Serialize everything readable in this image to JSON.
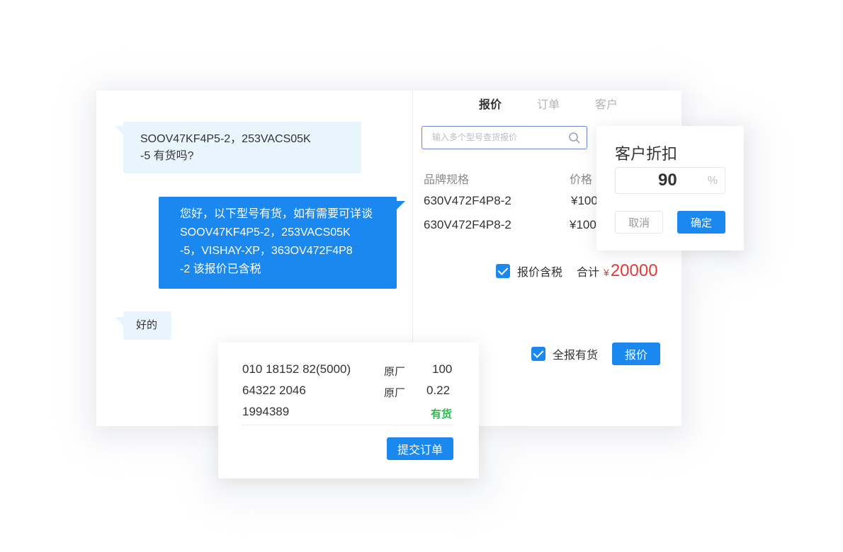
{
  "chat": {
    "msg_incoming_1": [
      "SOOV47KF4P5-2，253VACS05K",
      "-5 有货吗?"
    ],
    "msg_outgoing": [
      "您好，以下型号有货，如有需要可详谈",
      "SOOV47KF4P5-2，253VACS05K",
      "-5，VISHAY-XP，363OV472F4P8",
      "-2 该报价已含税"
    ],
    "msg_incoming_2": "好的"
  },
  "tabs": [
    {
      "label": "报价",
      "active": true
    },
    {
      "label": "订单",
      "active": false
    },
    {
      "label": "客户",
      "active": false
    }
  ],
  "search": {
    "placeholder": "输入多个型号查货报价",
    "icon": "search-icon"
  },
  "table": {
    "headers": {
      "brand_spec": "品牌规格",
      "price": "价格"
    },
    "rows": [
      {
        "spec": "630V472F4P8-2",
        "price": "¥100"
      },
      {
        "spec": "630V472F4P8-2",
        "price": "¥100"
      }
    ]
  },
  "tax": {
    "label": "报价含税",
    "checked": true
  },
  "total": {
    "label": "合计",
    "currency": "¥",
    "amount": "20000"
  },
  "all_stock": {
    "label": "全报有货",
    "checked": true
  },
  "quote_button": "报价",
  "discount_popup": {
    "title": "客户折扣",
    "value": "90",
    "unit": "%",
    "cancel": "取消",
    "confirm": "确定"
  },
  "order_popup": {
    "rows": [
      {
        "part": "010 18152 82(5000)",
        "brand": "原厂",
        "value": "100"
      },
      {
        "part": "64322 2046",
        "brand": "原厂",
        "value": "0.22"
      },
      {
        "part": "1994389",
        "brand": "",
        "value": "有货"
      }
    ],
    "submit": "提交订单"
  },
  "colors": {
    "accent": "#1a88ee",
    "total": "#e03a3a",
    "instock": "#2fb84f"
  }
}
